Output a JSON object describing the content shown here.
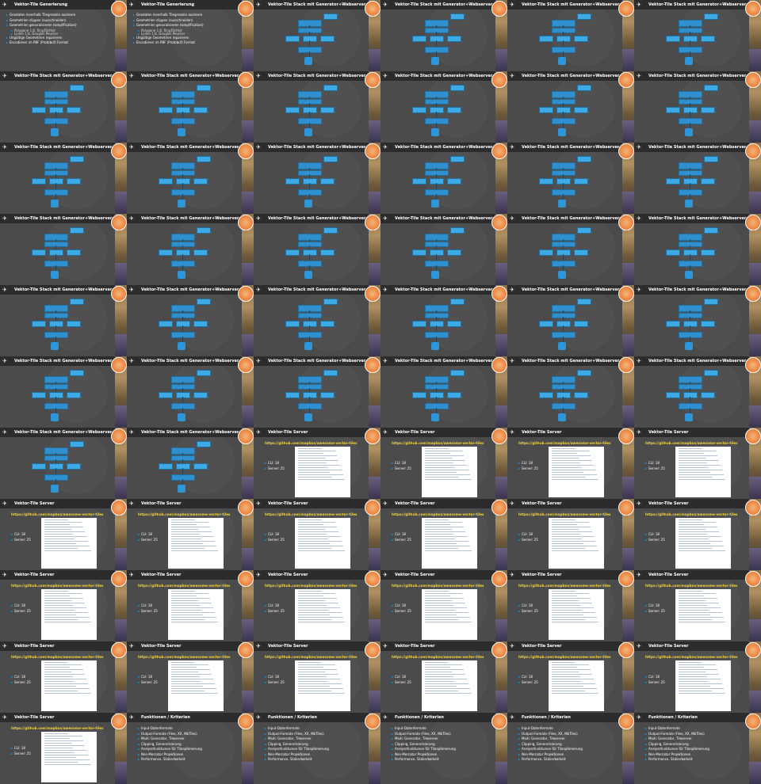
{
  "titles": {
    "generation": "Vektor-Tile Generierung",
    "stack": "Vektor-Tile Stack mit Generator+Webserver",
    "server": "Vektor-Tile Server",
    "features": "Funktionen / Kriterien"
  },
  "generation_bullets": [
    {
      "text": "Geodaten innerhalb Tilegrenzen auslesen",
      "level": 0
    },
    {
      "text": "Geometrien clippen (ausschneiden)",
      "level": 0
    },
    {
      "text": "Geometrien generalisieren (simplification)",
      "level": 0
    },
    {
      "text": "Polygone 1:8, RingTöchter",
      "level": 1
    },
    {
      "text": "Linien 1:8, Douglas Peucker",
      "level": 1
    },
    {
      "text": "Ungültige Geometrien reparieren",
      "level": 0
    },
    {
      "text": "Encodieren im PBF (Protobuf) Format",
      "level": 0
    }
  ],
  "server_link": "https://github.com/mapbox/awesome-vector-tiles",
  "server_bullets": [
    "CLI: 18",
    "Server: 25"
  ],
  "features_bullets": [
    "Input-Datenformate",
    "Output-Formate (Files, XX, MbTiles)",
    "Modi: Generator, Tileserver",
    "Clipping, Generalisierung",
    "Analysefunktionen für Tileoptimierung",
    "Non-Mercator Projektionen",
    "Performance, Skalierbarkeit"
  ],
  "slides": [
    "generation",
    "generation",
    "stack",
    "stack",
    "stack",
    "stack",
    "stack",
    "stack",
    "stack",
    "stack",
    "stack",
    "stack",
    "stack",
    "stack",
    "stack",
    "stack",
    "stack",
    "stack",
    "stack",
    "stack",
    "stack",
    "stack",
    "stack",
    "stack",
    "stack",
    "stack",
    "stack",
    "stack",
    "stack",
    "stack",
    "stack",
    "stack",
    "stack",
    "stack",
    "stack",
    "stack",
    "stack",
    "stack",
    "server",
    "server",
    "server",
    "server",
    "server",
    "server",
    "server",
    "server",
    "server",
    "server",
    "server",
    "server",
    "server",
    "server",
    "server",
    "server",
    "server",
    "server",
    "server",
    "server",
    "server",
    "server",
    "server",
    "features",
    "features",
    "features",
    "features",
    "features"
  ],
  "colors": {
    "slide_background": "#4b4b4b",
    "header_bar": "#2c2c2c",
    "accent_blue": "#3ea9e2",
    "link_yellow": "#f3d23c"
  },
  "icons": {
    "logo": "pin-logo-icon",
    "badge": "conference-badge-icon",
    "bullet": "bullet-icon"
  }
}
